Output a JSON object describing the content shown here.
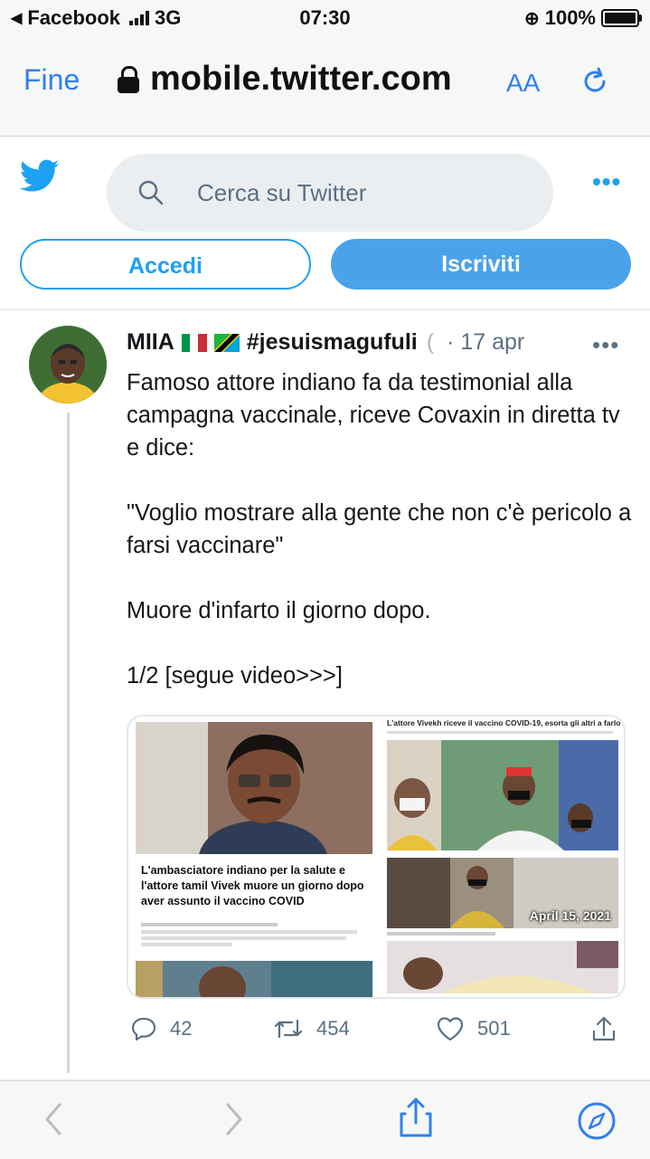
{
  "status_bar": {
    "back_app": "Facebook",
    "network": "3G",
    "time": "07:30",
    "battery": "100%"
  },
  "browser": {
    "done_label": "Fine",
    "url": "mobile.twitter.com",
    "text_size_label": "AA"
  },
  "twitter": {
    "search_placeholder": "Cerca su Twitter",
    "login_label": "Accedi",
    "signup_label": "Iscriviti"
  },
  "tweet": {
    "author": "MIIA",
    "handle_hashtag": "#jesuismagufuli",
    "date": "· 17 apr",
    "paragraphs": [
      "Famoso attore indiano fa da testimonial alla campagna vaccinale, riceve Covaxin in diretta tv e dice:",
      "\"Voglio mostrare alla gente che non c'è pericolo a farsi vaccinare\"",
      "Muore d'infarto il giorno dopo.",
      "1/2 [segue video>>>]"
    ],
    "media": {
      "left_caption": "L'ambasciatore indiano per la salute e l'attore tamil Vivek muore un giorno dopo aver assunto il vaccino COVID",
      "right_headline": "L'attore Vivekh riceve il vaccino COVID-19, esorta gli altri a farlo",
      "date_overlay": "April 15, 2021"
    },
    "actions": {
      "replies": "42",
      "retweets": "454",
      "likes": "501"
    }
  },
  "colors": {
    "twitter_blue": "#1da1f2",
    "safari_blue": "#2f80ed"
  }
}
